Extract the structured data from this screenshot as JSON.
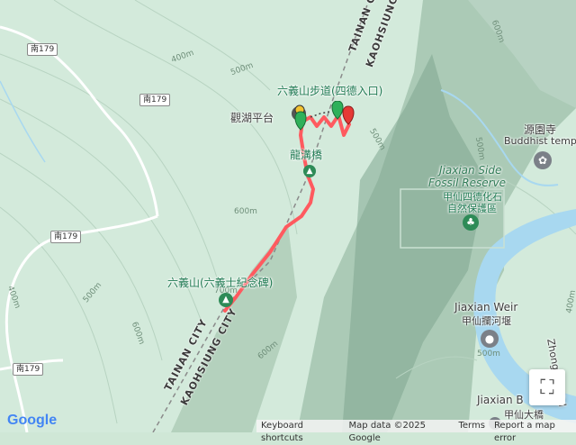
{
  "map": {
    "contour_labels": [
      "400m",
      "500m",
      "600m",
      "500m",
      "600m",
      "700m",
      "400m",
      "600m",
      "500m",
      "600m",
      "500m",
      "400m",
      "500m"
    ],
    "road_shields": [
      "南179",
      "南179",
      "南179",
      "南179"
    ],
    "boundary_labels": [
      "TAINAN CITY",
      "KAOHSIUNG CITY",
      "TAINAN CITY",
      "KAOHSIUNG CITY"
    ],
    "places": {
      "trailhead": "六義山步道(四德入口)",
      "viewpoint": "觀湖平台",
      "bridge": "龍溝橋",
      "peak": "六義山(六義士紀念碑)",
      "temple_zh": "源園寺",
      "temple_en": "Buddhist temple",
      "reserve_en_1": "Jiaxian Side",
      "reserve_en_2": "Fossil Reserve",
      "reserve_zh_1": "甲仙四德化石",
      "reserve_zh_2": "自然保護區",
      "weir_en": "Jiaxian Weir",
      "weir_zh": "甲仙攔河堰",
      "bridge2_en": "Jiaxian B",
      "bridge2_zh": "甲仙大橋",
      "road_right": "Zhongxiao Rd"
    },
    "colors": {
      "track": "#ff5a5f",
      "terrain": "#cfe7d6",
      "river": "#a8d8f0",
      "poi_green": "#2e8b57"
    }
  },
  "footer": {
    "google": "Google",
    "keyboard": "Keyboard shortcuts",
    "mapdata": "Map data ©2025 Google",
    "terms": "Terms",
    "report": "Report a map error"
  }
}
